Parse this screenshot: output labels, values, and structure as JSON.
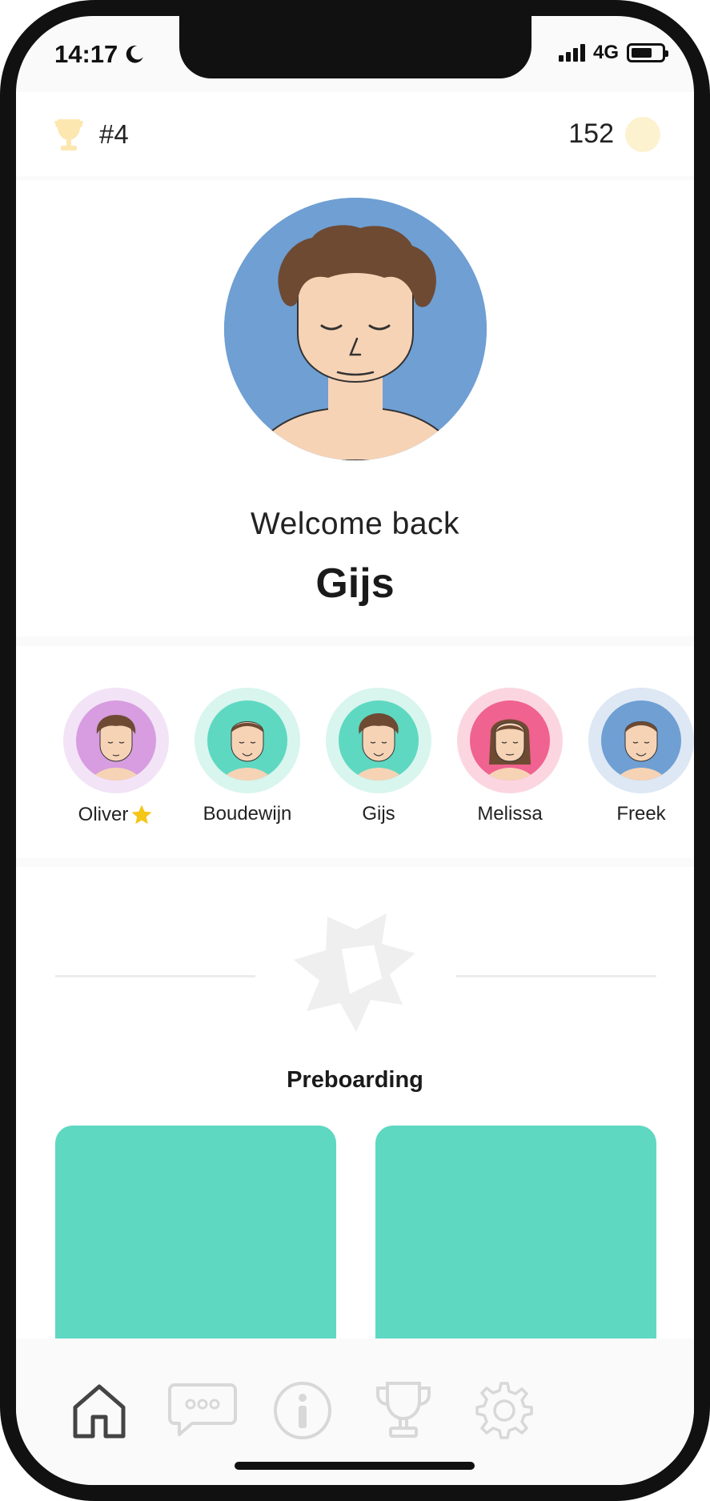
{
  "status_bar": {
    "time": "14:17",
    "network": "4G",
    "icons": [
      "moon-icon",
      "signal-icon",
      "battery-icon"
    ]
  },
  "header": {
    "rank": "#4",
    "coins": "152",
    "icons": [
      "trophy-icon",
      "coin-icon"
    ]
  },
  "profile": {
    "welcome": "Welcome back",
    "name": "Gijs",
    "avatar_bg": "#6f9fd3"
  },
  "team": {
    "members": [
      {
        "name": "Oliver",
        "ring": "#f3e3f7",
        "bg": "#d79de0",
        "starred": true
      },
      {
        "name": "Boudewijn",
        "ring": "#d8f5ee",
        "bg": "#5ed8c1",
        "starred": false
      },
      {
        "name": "Gijs",
        "ring": "#d8f5ee",
        "bg": "#5ed8c1",
        "starred": false
      },
      {
        "name": "Melissa",
        "ring": "#fbd6e1",
        "bg": "#f0628f",
        "starred": false
      },
      {
        "name": "Freek",
        "ring": "#dde8f4",
        "bg": "#6f9fd3",
        "starred": false
      }
    ]
  },
  "section": {
    "title": "Preboarding",
    "tile_color": "#5ed8c1"
  },
  "tabbar": {
    "tabs": [
      "home-icon",
      "chat-icon",
      "info-icon",
      "trophy-icon",
      "settings-icon"
    ],
    "active": "home-icon"
  },
  "colors": {
    "accent": "#5ed8c1",
    "star": "#f5c518",
    "inactive_icon": "#d8d8d8",
    "active_icon": "#444444"
  }
}
